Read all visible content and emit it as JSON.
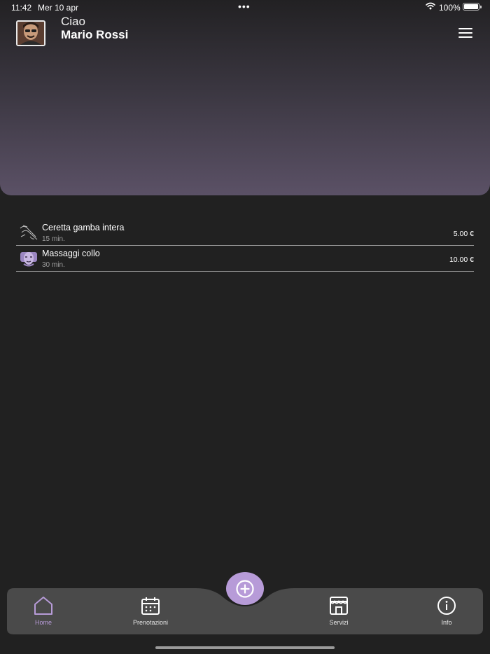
{
  "status_bar": {
    "time": "11:42",
    "date": "Mer 10 apr",
    "battery": "100%"
  },
  "header": {
    "greeting": "Ciao",
    "user_name": "Mario Rossi"
  },
  "services": [
    {
      "name": "Ceretta gamba intera",
      "duration": "15 min.",
      "price": "5.00 €",
      "icon": "leg-wax-icon"
    },
    {
      "name": "Massaggi collo",
      "duration": "30 min.",
      "price": "10.00 €",
      "icon": "neck-massage-icon"
    }
  ],
  "tabbar": {
    "tabs": [
      {
        "label": "Home",
        "icon": "home-icon"
      },
      {
        "label": "Prenotazioni",
        "icon": "calendar-icon"
      },
      {
        "label": "Servizi",
        "icon": "store-icon"
      },
      {
        "label": "Info",
        "icon": "info-icon"
      }
    ],
    "active_tab": "Home",
    "fab_icon": "plus-circle-icon"
  },
  "colors": {
    "background": "#212121",
    "accent": "#b79bd8",
    "tabbar": "#4a4a4a",
    "header_gradient_end": "#5b5166"
  }
}
